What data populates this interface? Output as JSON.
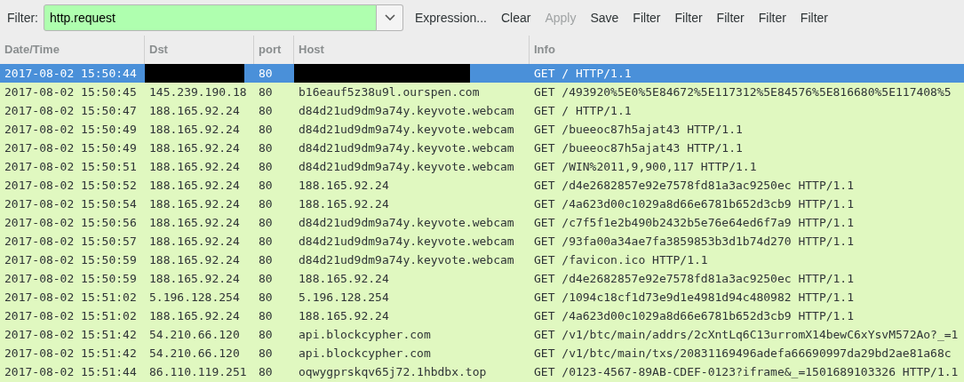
{
  "toolbar": {
    "label": "Filter:",
    "filter": {
      "value": "http.request",
      "valid": true
    },
    "buttons": [
      {
        "label": "Expression...",
        "disabled": false
      },
      {
        "label": "Clear",
        "disabled": false
      },
      {
        "label": "Apply",
        "disabled": true
      },
      {
        "label": "Save",
        "disabled": false
      },
      {
        "label": "Filter",
        "disabled": false
      },
      {
        "label": "Filter",
        "disabled": false
      },
      {
        "label": "Filter",
        "disabled": false
      },
      {
        "label": "Filter",
        "disabled": false
      },
      {
        "label": "Filter",
        "disabled": false
      }
    ]
  },
  "table": {
    "columns": [
      "Date/Time",
      "Dst",
      "port",
      "Host",
      "Info"
    ],
    "rows": [
      {
        "selected": true,
        "redacted": true,
        "cells": [
          "2017-08-02 15:50:44",
          "",
          "80",
          "",
          "GET / HTTP/1.1"
        ]
      },
      {
        "selected": false,
        "redacted": false,
        "cells": [
          "2017-08-02 15:50:45",
          "145.239.190.18",
          "80",
          "b16eauf5z38u9l.ourspen.com",
          "GET /493920%5E0%5E84672%5E117312%5E84576%5E816680%5E117408%5"
        ]
      },
      {
        "selected": false,
        "redacted": false,
        "cells": [
          "2017-08-02 15:50:47",
          "188.165.92.24",
          "80",
          "d84d21ud9dm9a74y.keyvote.webcam",
          "GET / HTTP/1.1"
        ]
      },
      {
        "selected": false,
        "redacted": false,
        "cells": [
          "2017-08-02 15:50:49",
          "188.165.92.24",
          "80",
          "d84d21ud9dm9a74y.keyvote.webcam",
          "GET /bueeoc87h5ajat43 HTTP/1.1"
        ]
      },
      {
        "selected": false,
        "redacted": false,
        "cells": [
          "2017-08-02 15:50:49",
          "188.165.92.24",
          "80",
          "d84d21ud9dm9a74y.keyvote.webcam",
          "GET /bueeoc87h5ajat43 HTTP/1.1"
        ]
      },
      {
        "selected": false,
        "redacted": false,
        "cells": [
          "2017-08-02 15:50:51",
          "188.165.92.24",
          "80",
          "d84d21ud9dm9a74y.keyvote.webcam",
          "GET /WIN%2011,9,900,117 HTTP/1.1"
        ]
      },
      {
        "selected": false,
        "redacted": false,
        "cells": [
          "2017-08-02 15:50:52",
          "188.165.92.24",
          "80",
          "188.165.92.24",
          "GET /d4e2682857e92e7578fd81a3ac9250ec HTTP/1.1"
        ]
      },
      {
        "selected": false,
        "redacted": false,
        "cells": [
          "2017-08-02 15:50:54",
          "188.165.92.24",
          "80",
          "188.165.92.24",
          "GET /4a623d00c1029a8d66e6781b652d3cb9 HTTP/1.1"
        ]
      },
      {
        "selected": false,
        "redacted": false,
        "cells": [
          "2017-08-02 15:50:56",
          "188.165.92.24",
          "80",
          "d84d21ud9dm9a74y.keyvote.webcam",
          "GET /c7f5f1e2b490b2432b5e76e64ed6f7a9 HTTP/1.1"
        ]
      },
      {
        "selected": false,
        "redacted": false,
        "cells": [
          "2017-08-02 15:50:57",
          "188.165.92.24",
          "80",
          "d84d21ud9dm9a74y.keyvote.webcam",
          "GET /93fa00a34ae7fa3859853b3d1b74d270 HTTP/1.1"
        ]
      },
      {
        "selected": false,
        "redacted": false,
        "cells": [
          "2017-08-02 15:50:59",
          "188.165.92.24",
          "80",
          "d84d21ud9dm9a74y.keyvote.webcam",
          "GET /favicon.ico HTTP/1.1"
        ]
      },
      {
        "selected": false,
        "redacted": false,
        "cells": [
          "2017-08-02 15:50:59",
          "188.165.92.24",
          "80",
          "188.165.92.24",
          "GET /d4e2682857e92e7578fd81a3ac9250ec HTTP/1.1"
        ]
      },
      {
        "selected": false,
        "redacted": false,
        "cells": [
          "2017-08-02 15:51:02",
          "5.196.128.254",
          "80",
          "5.196.128.254",
          "GET /1094c18cf1d73e9d1e4981d94c480982 HTTP/1.1"
        ]
      },
      {
        "selected": false,
        "redacted": false,
        "cells": [
          "2017-08-02 15:51:02",
          "188.165.92.24",
          "80",
          "188.165.92.24",
          "GET /4a623d00c1029a8d66e6781b652d3cb9 HTTP/1.1"
        ]
      },
      {
        "selected": false,
        "redacted": false,
        "cells": [
          "2017-08-02 15:51:42",
          "54.210.66.120",
          "80",
          "api.blockcypher.com",
          "GET /v1/btc/main/addrs/2cXntLq6C13urromX14bewC6xYsvM572Ao?_=1"
        ]
      },
      {
        "selected": false,
        "redacted": false,
        "cells": [
          "2017-08-02 15:51:42",
          "54.210.66.120",
          "80",
          "api.blockcypher.com",
          "GET /v1/btc/main/txs/20831169496adefa66690997da29bd2ae81a68c"
        ]
      },
      {
        "selected": false,
        "redacted": false,
        "cells": [
          "2017-08-02 15:51:44",
          "86.110.119.251",
          "80",
          "oqwygprskqv65j72.1hbdbx.top",
          "GET /0123-4567-89AB-CDEF-0123?iframe&_=1501689103326 HTTP/1.1"
        ]
      }
    ]
  }
}
